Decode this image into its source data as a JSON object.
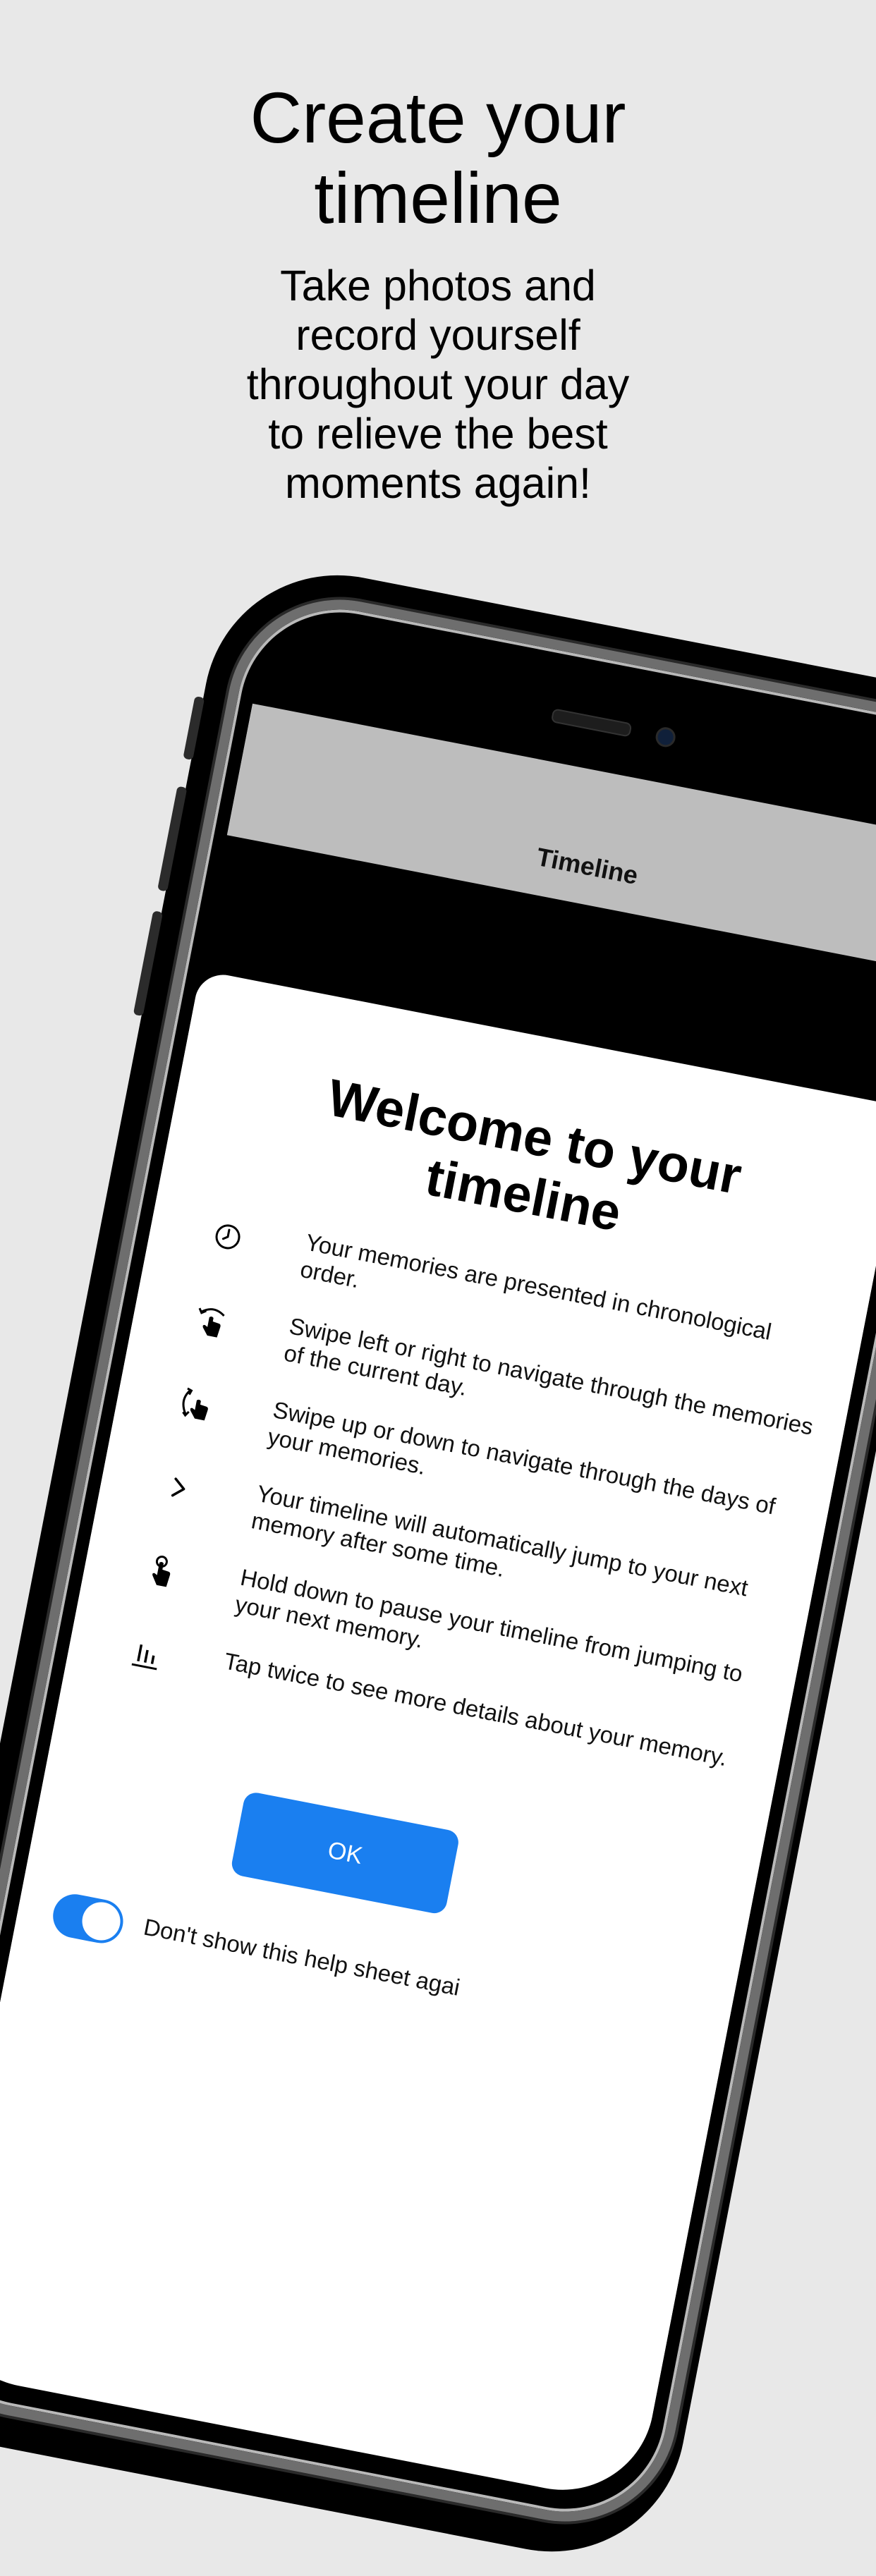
{
  "promo": {
    "headline": [
      "Create your",
      "timeline"
    ],
    "subhead": [
      "Take photos and",
      "record yourself",
      "throughout your day",
      "to relieve the best",
      "moments again!"
    ]
  },
  "nav": {
    "title": "Timeline"
  },
  "sheet": {
    "title": [
      "Welcome to your",
      "timeline"
    ],
    "items": [
      {
        "icon": "clock-icon",
        "text": "Your memories are presented in chronological order."
      },
      {
        "icon": "swipe-horizontal-icon",
        "text": "Swipe left or right to navigate through the memories of the current day."
      },
      {
        "icon": "swipe-vertical-icon",
        "text": "Swipe up or down to navigate through the days of your memories."
      },
      {
        "icon": "chevron-right-icon",
        "text": "Your timeline will automatically jump to your next memory after some time."
      },
      {
        "icon": "hold-hand-icon",
        "text": "Hold down to pause your timeline from jumping to your next memory."
      },
      {
        "icon": "details-icon",
        "text": "Tap twice to see more details about your memory."
      }
    ],
    "ok_label": "OK",
    "toggle_label": "Don't show this help sheet agai",
    "toggle_on": true
  },
  "colors": {
    "accent": "#1a7ff0",
    "background": "#e8e8e8",
    "navbar": "#bdbdbd"
  }
}
